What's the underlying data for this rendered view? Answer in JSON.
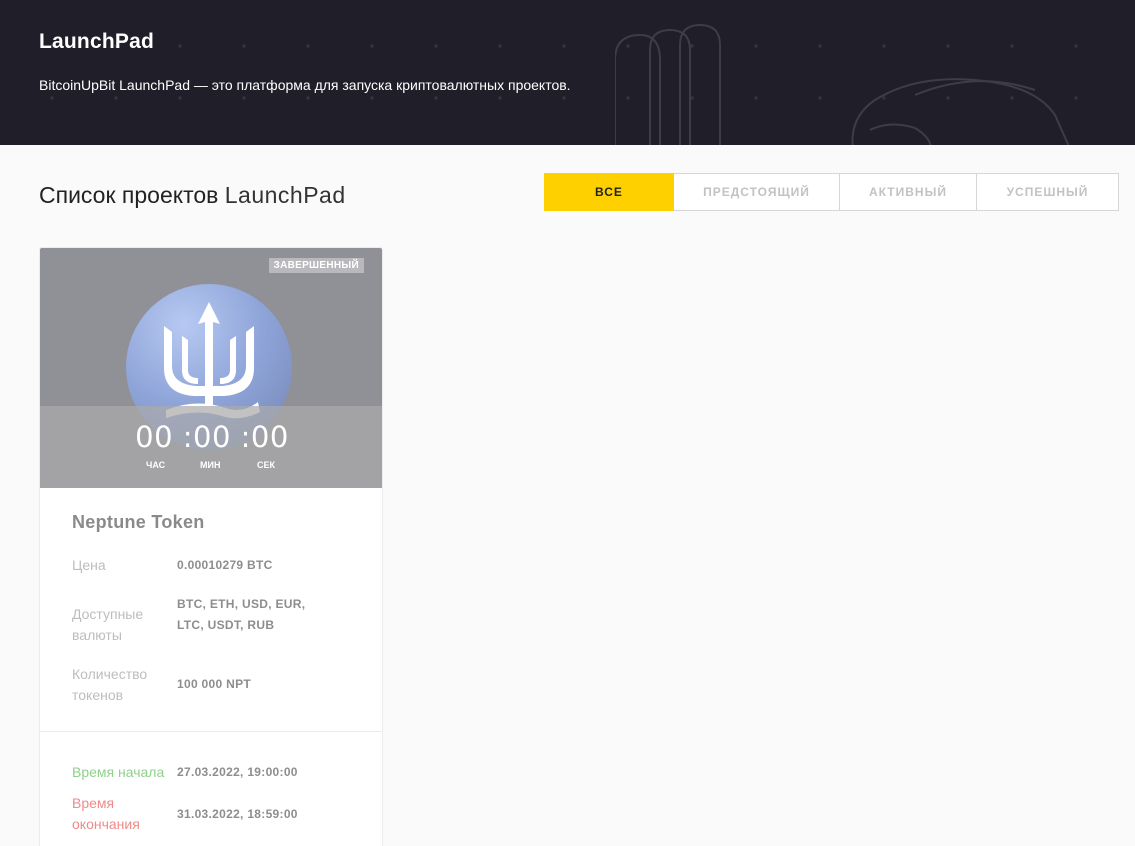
{
  "banner": {
    "title": "LaunchPad",
    "subtitle": "BitcoinUpBit LaunchPad — это платформа для запуска криптовалютных проектов."
  },
  "section": {
    "title_main": "Список проектов",
    "title_accent": "LaunchPad"
  },
  "tabs": [
    {
      "label": "ВСЕ",
      "active": true
    },
    {
      "label": "ПРЕДСТОЯЩИЙ",
      "active": false
    },
    {
      "label": "АКТИВНЫЙ",
      "active": false
    },
    {
      "label": "УСПЕШНЫЙ",
      "active": false
    }
  ],
  "card": {
    "badge": "ЗАВЕРШЕННЫЙ",
    "logo_icon": "trident-icon",
    "timer": {
      "display": "00 :00 :00",
      "hours_label": "ЧАС",
      "minutes_label": "МИН",
      "seconds_label": "СЕК"
    },
    "name": "Neptune Token",
    "price_label": "Цена",
    "price_value": "0.00010279 BTC",
    "currencies_label": "Доступные валюты",
    "currencies_value": "BTC, ETH, USD, EUR, LTC, USDT, RUB",
    "tokens_label": "Количество токенов",
    "tokens_value": "100 000 NPT",
    "start_label": "Время начала",
    "start_value": "27.03.2022, 19:00:00",
    "end_label": "Время окончания",
    "end_value": "31.03.2022, 18:59:00"
  },
  "colors": {
    "banner_bg": "#1f1e29",
    "accent_yellow": "#ffd000",
    "start_green": "#8fd18d",
    "end_red": "#ef8a8a"
  }
}
